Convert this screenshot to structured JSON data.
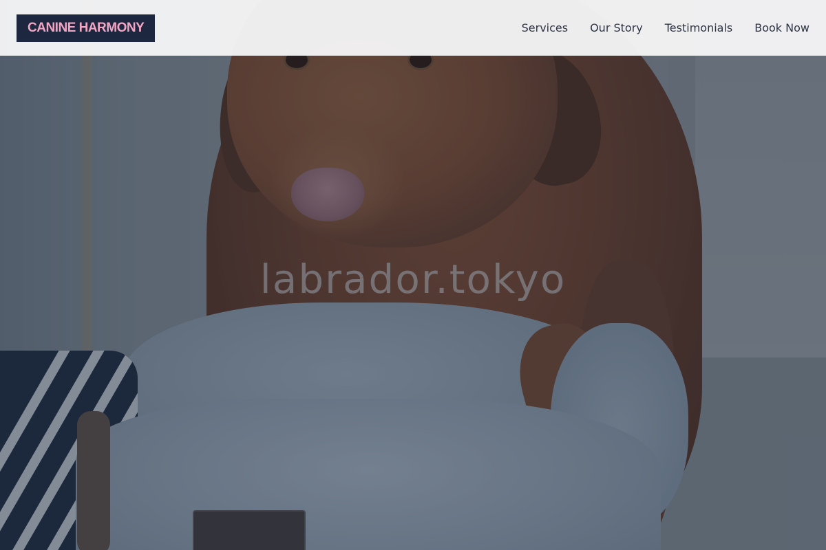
{
  "header": {
    "logo_text": "CANINE HARMONY",
    "nav_items": [
      {
        "label": "Services"
      },
      {
        "label": "Our Story"
      },
      {
        "label": "Testimonials"
      },
      {
        "label": "Book Now"
      }
    ]
  },
  "hero": {
    "watermark": "labrador.tokyo"
  },
  "colors": {
    "logo_bg": "#1d2740",
    "logo_text": "#f2a6c3",
    "header_bg": "#f5f5f6"
  }
}
